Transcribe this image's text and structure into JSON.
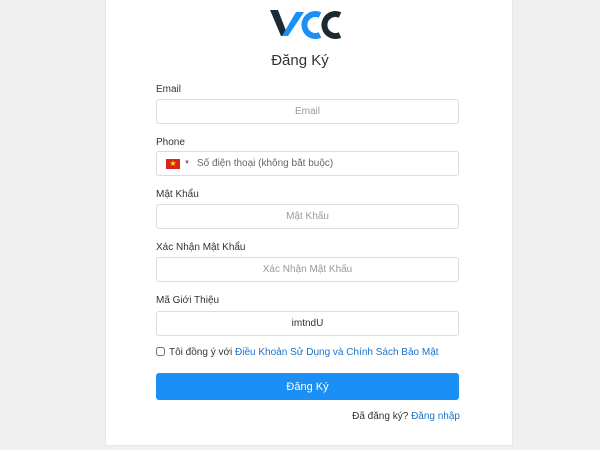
{
  "form": {
    "title": "Đăng Ký",
    "email": {
      "label": "Email",
      "placeholder": "Email"
    },
    "phone": {
      "label": "Phone",
      "placeholder": "Số điện thoại (không bắt buộc)",
      "country_flag": "vietnam-flag-icon"
    },
    "password": {
      "label": "Mật Khẩu",
      "placeholder": "Mật Khẩu"
    },
    "confirm_password": {
      "label": "Xác Nhận Mật Khẩu",
      "placeholder": "Xác Nhận Mật Khẩu"
    },
    "referral": {
      "label": "Mã Giới Thiệu",
      "value": "imtndU"
    },
    "agree": {
      "prefix": "Tôi đồng ý với",
      "link": "Điều Khoản Sử Dụng và Chính Sách Bảo Mật",
      "checked": false
    },
    "submit_label": "Đăng Ký",
    "login": {
      "prompt": "Đã đăng ký?",
      "link": "Đăng nhập"
    }
  },
  "colors": {
    "brand_dark": "#1c2b33",
    "accent": "#1a8ff5",
    "link": "#1a73c9"
  }
}
